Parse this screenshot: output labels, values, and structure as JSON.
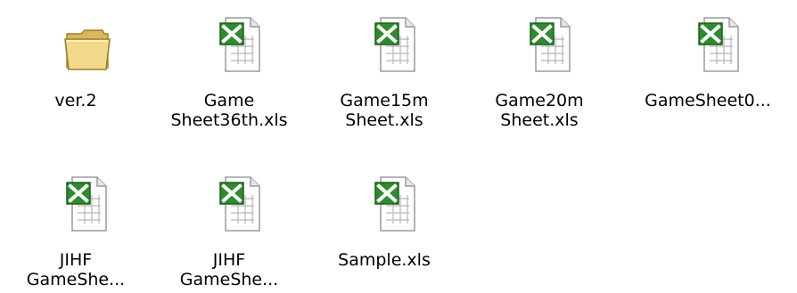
{
  "window": {
    "title": ""
  },
  "items": [
    {
      "label": "ver.2",
      "icon": "folder-icon"
    },
    {
      "label": "Game\nSheet36th.xls",
      "icon": "excel-file-icon"
    },
    {
      "label": "Game15m\nSheet.xls",
      "icon": "excel-file-icon"
    },
    {
      "label": "Game20m\nSheet.xls",
      "icon": "excel-file-icon"
    },
    {
      "label": "GameSheet0...",
      "icon": "excel-file-icon"
    },
    {
      "label": "JIHF\nGameShe...",
      "icon": "excel-file-icon"
    },
    {
      "label": "JIHF\nGameShe...",
      "icon": "excel-file-icon"
    },
    {
      "label": "Sample.xls",
      "icon": "excel-file-icon"
    }
  ],
  "colors": {
    "folder": "#F3D98C",
    "excel_green": "#2E8B2E",
    "page": "#FFFFFF",
    "grid": "#9E9E9E"
  }
}
